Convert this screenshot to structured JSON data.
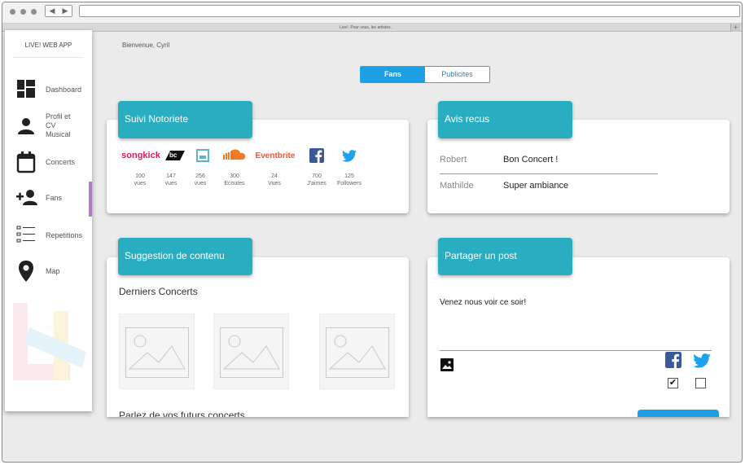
{
  "browser": {
    "tab_title": "Live!. Pour vous, les artistes.",
    "nav_back": "◀",
    "nav_forward": "▶",
    "new_tab": "+"
  },
  "sidebar": {
    "brand": "LIVE! WEB APP",
    "items": [
      {
        "label": "Dashboard",
        "icon": "dashboard-icon"
      },
      {
        "label": "Profil et CV Musical",
        "lines": [
          "Profil et",
          "CV",
          "Musical"
        ],
        "icon": "person-icon"
      },
      {
        "label": "Concerts",
        "icon": "calendar-icon"
      },
      {
        "label": "Fans",
        "icon": "add-person-icon",
        "active": true
      },
      {
        "label": "Repetitions",
        "icon": "checklist-icon"
      },
      {
        "label": "Map",
        "icon": "map-pin-icon"
      }
    ]
  },
  "header": {
    "greeting": "Bienvenue, Cyril"
  },
  "toggle": {
    "active": "Fans",
    "inactive": "Publicites"
  },
  "notoriety": {
    "title": "Suivi Notoriete",
    "platforms": [
      {
        "logo": "songkick",
        "value": "100",
        "unit": "vues"
      },
      {
        "logo": "bc",
        "value": "147",
        "unit": "vues"
      },
      {
        "logo": "bandsintown-icon",
        "value": "256",
        "unit": "vues"
      },
      {
        "logo": "soundcloud-icon",
        "value": "300",
        "unit": "Ecoutes"
      },
      {
        "logo": "Eventbrite",
        "value": "24",
        "unit": "Vues"
      },
      {
        "logo": "facebook-icon",
        "value": "700",
        "unit": "J'aimes"
      },
      {
        "logo": "twitter-icon",
        "value": "125",
        "unit": "Followers"
      }
    ]
  },
  "reviews": {
    "title": "Avis recus",
    "items": [
      {
        "name": "Robert",
        "text": "Bon Concert !"
      },
      {
        "name": "Mathilde",
        "text": "Super ambiance"
      }
    ]
  },
  "suggestion": {
    "title": "Suggestion de contenu",
    "section1": "Derniers Concerts",
    "section2": "Parlez de vos futurs concerts"
  },
  "share": {
    "title": "Partager un post",
    "text": "Venez nous voir ce soir!",
    "facebook_checked": "✔",
    "twitter_checked": ""
  },
  "colors": {
    "accent": "#29adc0",
    "primary": "#1f9fe3",
    "active_marker": "#b07cc6"
  }
}
